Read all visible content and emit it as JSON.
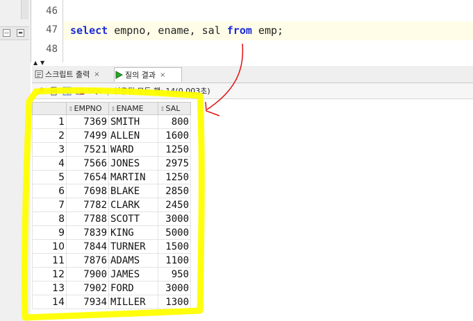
{
  "editor": {
    "lines": [
      {
        "number": "46",
        "text": ""
      },
      {
        "number": "47",
        "tokens": [
          {
            "text": "select",
            "keyword": true
          },
          {
            "text": " empno, ename, sal ",
            "keyword": false
          },
          {
            "text": "from",
            "keyword": true
          },
          {
            "text": " emp;",
            "keyword": false
          }
        ]
      },
      {
        "number": "48",
        "text": ""
      }
    ]
  },
  "tabs": [
    {
      "label": "스크립트 출력",
      "icon": "script-output-icon"
    },
    {
      "label": "질의 결과",
      "icon": "run-query-icon",
      "active": true
    }
  ],
  "toolbar": {
    "sql_label": "SQL",
    "status": "인출된 모든 행: 14(0.003초)"
  },
  "grid": {
    "columns": [
      "EMPNO",
      "ENAME",
      "SAL"
    ],
    "rows": [
      [
        "1",
        "7369",
        "SMITH",
        "800"
      ],
      [
        "2",
        "7499",
        "ALLEN",
        "1600"
      ],
      [
        "3",
        "7521",
        "WARD",
        "1250"
      ],
      [
        "4",
        "7566",
        "JONES",
        "2975"
      ],
      [
        "5",
        "7654",
        "MARTIN",
        "1250"
      ],
      [
        "6",
        "7698",
        "BLAKE",
        "2850"
      ],
      [
        "7",
        "7782",
        "CLARK",
        "2450"
      ],
      [
        "8",
        "7788",
        "SCOTT",
        "3000"
      ],
      [
        "9",
        "7839",
        "KING",
        "5000"
      ],
      [
        "10",
        "7844",
        "TURNER",
        "1500"
      ],
      [
        "11",
        "7876",
        "ADAMS",
        "1100"
      ],
      [
        "12",
        "7900",
        "JAMES",
        "950"
      ],
      [
        "13",
        "7902",
        "FORD",
        "3000"
      ],
      [
        "14",
        "7934",
        "MILLER",
        "1300"
      ]
    ]
  },
  "colors": {
    "keyword": "#1a2bd6",
    "highlight_yellow": "#ffff00",
    "annotation_red": "#e01010"
  }
}
